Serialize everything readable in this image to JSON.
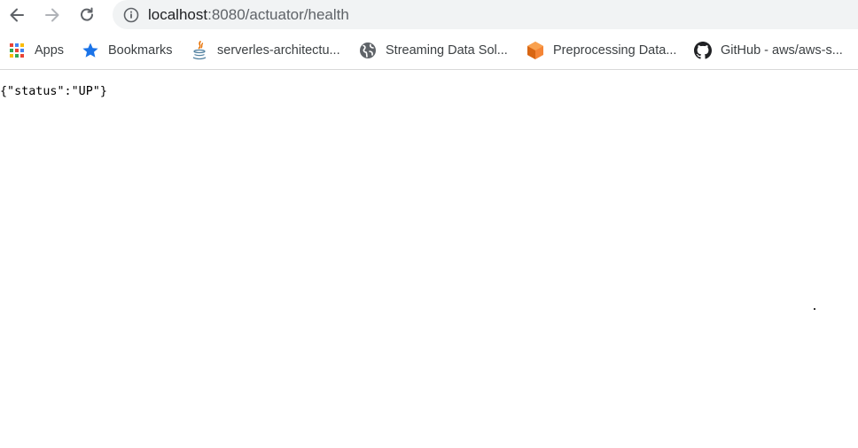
{
  "browser": {
    "url_host": "localhost",
    "url_rest": ":8080/actuator/health"
  },
  "bookmarks": [
    {
      "label": "Apps",
      "icon": "apps-grid-icon"
    },
    {
      "label": "Bookmarks",
      "icon": "star-icon"
    },
    {
      "label": "serverles-architectu...",
      "icon": "java-icon"
    },
    {
      "label": "Streaming Data Sol...",
      "icon": "globe-icon"
    },
    {
      "label": "Preprocessing Data...",
      "icon": "aws-cube-icon"
    },
    {
      "label": "GitHub - aws/aws-s...",
      "icon": "github-icon"
    }
  ],
  "page": {
    "body_text": "{\"status\":\"UP\"}"
  },
  "colors": {
    "omnibox_bg": "#f1f3f4",
    "star_blue": "#1a73e8",
    "aws_orange": "#f58536"
  }
}
